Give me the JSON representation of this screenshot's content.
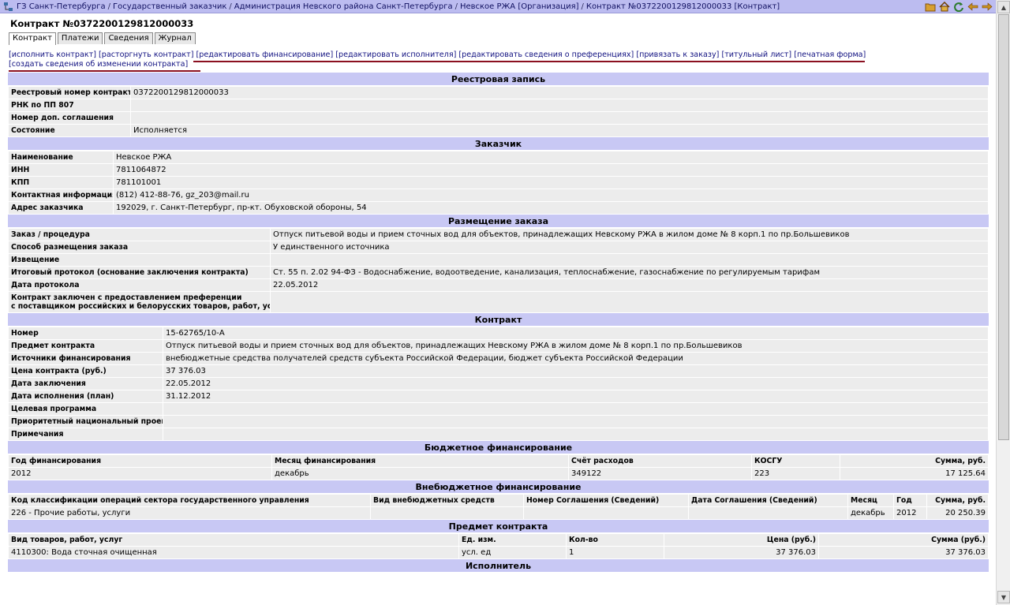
{
  "breadcrumb": [
    "ГЗ Санкт-Петербурга",
    "Государственный заказчик",
    "Администрация Невского района Санкт-Петербурга",
    "Невское РЖА [Организация]",
    "Контракт №0372200129812000033 [Контракт]"
  ],
  "breadcrumb_sep": "/",
  "page_title": "Контракт №0372200129812000033",
  "tabs": [
    "Контракт",
    "Платежи",
    "Сведения",
    "Журнал"
  ],
  "actions": [
    "[исполнить контракт]",
    "[расторгнуть контракт]",
    "[редактировать финансирование]",
    "[редактировать исполнителя]",
    "[редактировать сведения о преференциях]",
    "[привязать к заказу]",
    "[титульный лист]",
    "[печатная форма]",
    "[создать сведения об изменении контракта]"
  ],
  "registry": {
    "title": "Реестровая запись",
    "rows": [
      [
        "Реестровый номер контракта",
        "0372200129812000033"
      ],
      [
        "РНК по ПП 807",
        ""
      ],
      [
        "Номер доп. соглашения",
        ""
      ],
      [
        "Состояние",
        "Исполняется"
      ]
    ]
  },
  "customer": {
    "title": "Заказчик",
    "rows": [
      [
        "Наименование",
        "Невское РЖА"
      ],
      [
        "ИНН",
        "7811064872"
      ],
      [
        "КПП",
        "781101001"
      ],
      [
        "Контактная информация",
        "(812) 412-88-76, gz_203@mail.ru"
      ],
      [
        "Адрес заказчика",
        "192029, г. Санкт-Петербург, пр-кт. Обуховской обороны, 54"
      ]
    ]
  },
  "placement": {
    "title": "Размещение заказа",
    "rows": [
      [
        "Заказ / процедура",
        "Отпуск питьевой воды и прием сточных вод для объектов, принадлежащих Невскому РЖА в жилом доме № 8 корп.1 по пр.Большевиков"
      ],
      [
        "Способ размещения заказа",
        "У единственного источника"
      ],
      [
        "Извещение",
        ""
      ],
      [
        "Итоговый протокол (основание заключения контракта)",
        "Ст. 55 п. 2.02 94-ФЗ - Водоснабжение, водоотведение, канализация, теплоснабжение, газоснабжение по регулируемым тарифам"
      ],
      [
        "Дата протокола",
        "22.05.2012"
      ]
    ],
    "preference_label_1": "Контракт заключен с предоставлением преференции",
    "preference_label_2": "с поставщиком российских и белорусских товаров, работ, услуг"
  },
  "contract": {
    "title": "Контракт",
    "rows": [
      [
        "Номер",
        "15-62765/10-А"
      ],
      [
        "Предмет контракта",
        "Отпуск питьевой воды и прием сточных вод для объектов, принадлежащих Невскому РЖА в жилом доме № 8 корп.1 по пр.Большевиков"
      ],
      [
        "Источники финансирования",
        "внебюджетные средства получателей средств субъекта Российской Федерации, бюджет субъекта Российской Федерации"
      ],
      [
        "Цена контракта (руб.)",
        "37 376.03"
      ],
      [
        "Дата заключения",
        "22.05.2012"
      ],
      [
        "Дата исполнения (план)",
        "31.12.2012"
      ],
      [
        "Целевая программа",
        ""
      ],
      [
        "Приоритетный национальный проект",
        ""
      ],
      [
        "Примечания",
        ""
      ]
    ]
  },
  "budget": {
    "title": "Бюджетное финансирование",
    "headers": [
      "Год финансирования",
      "Месяц финансирования",
      "Счёт расходов",
      "КОСГУ",
      "Сумма, руб."
    ],
    "row": [
      "2012",
      "декабрь",
      "349122",
      "223",
      "17 125.64"
    ]
  },
  "offbudget": {
    "title": "Внебюджетное финансирование",
    "headers": [
      "Код классификации операций сектора государственного управления",
      "Вид внебюджетных средств",
      "Номер Соглашения (Сведений)",
      "Дата Соглашения (Сведений)",
      "Месяц",
      "Год",
      "Сумма, руб."
    ],
    "row": [
      "226 - Прочие работы, услуги",
      "",
      "",
      "",
      "декабрь",
      "2012",
      "20 250.39"
    ]
  },
  "subject": {
    "title": "Предмет контракта",
    "headers": [
      "Вид товаров, работ, услуг",
      "Ед. изм.",
      "Кол-во",
      "Цена (руб.)",
      "Сумма (руб.)"
    ],
    "row": [
      "4110300: Вода сточная очищенная",
      "усл. ед",
      "1",
      "37 376.03",
      "37 376.03"
    ]
  },
  "executor": {
    "title": "Исполнитель"
  },
  "colors": {
    "topbar": "#bcbcf0",
    "section_header": "#c8c8f4",
    "cell": "#ececec",
    "highlight_line": "#8b1020"
  }
}
